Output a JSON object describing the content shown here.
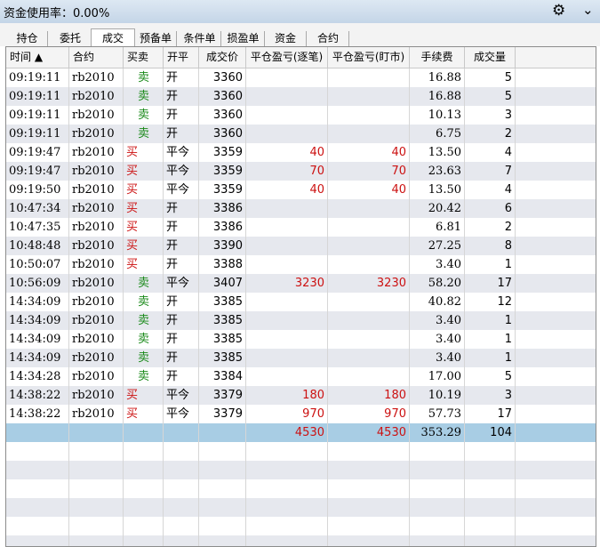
{
  "title_bar": {
    "label": "资金使用率：0.00%"
  },
  "tabs": [
    "持仓",
    "委托",
    "成交",
    "预备单",
    "条件单",
    "损盈单",
    "资金",
    "合约"
  ],
  "active_tab": 2,
  "columns": [
    "时间 ▲",
    "合约",
    "买卖",
    "开平",
    "成交价",
    "平仓盈亏(逐笔)",
    "平仓盈亏(盯市)",
    "手续费",
    "成交量"
  ],
  "rows": [
    {
      "time": "09:19:11",
      "contract": "rb2010",
      "side": "卖",
      "oc": "开",
      "price": "3360",
      "pnl_trade": "",
      "pnl_mark": "",
      "fee": "16.88",
      "qty": "5"
    },
    {
      "time": "09:19:11",
      "contract": "rb2010",
      "side": "卖",
      "oc": "开",
      "price": "3360",
      "pnl_trade": "",
      "pnl_mark": "",
      "fee": "16.88",
      "qty": "5"
    },
    {
      "time": "09:19:11",
      "contract": "rb2010",
      "side": "卖",
      "oc": "开",
      "price": "3360",
      "pnl_trade": "",
      "pnl_mark": "",
      "fee": "10.13",
      "qty": "3"
    },
    {
      "time": "09:19:11",
      "contract": "rb2010",
      "side": "卖",
      "oc": "开",
      "price": "3360",
      "pnl_trade": "",
      "pnl_mark": "",
      "fee": "6.75",
      "qty": "2"
    },
    {
      "time": "09:19:47",
      "contract": "rb2010",
      "side": "买",
      "oc": "平今",
      "price": "3359",
      "pnl_trade": "40",
      "pnl_mark": "40",
      "fee": "13.50",
      "qty": "4"
    },
    {
      "time": "09:19:47",
      "contract": "rb2010",
      "side": "买",
      "oc": "平今",
      "price": "3359",
      "pnl_trade": "70",
      "pnl_mark": "70",
      "fee": "23.63",
      "qty": "7"
    },
    {
      "time": "09:19:50",
      "contract": "rb2010",
      "side": "买",
      "oc": "平今",
      "price": "3359",
      "pnl_trade": "40",
      "pnl_mark": "40",
      "fee": "13.50",
      "qty": "4"
    },
    {
      "time": "10:47:34",
      "contract": "rb2010",
      "side": "买",
      "oc": "开",
      "price": "3386",
      "pnl_trade": "",
      "pnl_mark": "",
      "fee": "20.42",
      "qty": "6"
    },
    {
      "time": "10:47:35",
      "contract": "rb2010",
      "side": "买",
      "oc": "开",
      "price": "3386",
      "pnl_trade": "",
      "pnl_mark": "",
      "fee": "6.81",
      "qty": "2"
    },
    {
      "time": "10:48:48",
      "contract": "rb2010",
      "side": "买",
      "oc": "开",
      "price": "3390",
      "pnl_trade": "",
      "pnl_mark": "",
      "fee": "27.25",
      "qty": "8"
    },
    {
      "time": "10:50:07",
      "contract": "rb2010",
      "side": "买",
      "oc": "开",
      "price": "3388",
      "pnl_trade": "",
      "pnl_mark": "",
      "fee": "3.40",
      "qty": "1"
    },
    {
      "time": "10:56:09",
      "contract": "rb2010",
      "side": "卖",
      "oc": "平今",
      "price": "3407",
      "pnl_trade": "3230",
      "pnl_mark": "3230",
      "fee": "58.20",
      "qty": "17"
    },
    {
      "time": "14:34:09",
      "contract": "rb2010",
      "side": "卖",
      "oc": "开",
      "price": "3385",
      "pnl_trade": "",
      "pnl_mark": "",
      "fee": "40.82",
      "qty": "12"
    },
    {
      "time": "14:34:09",
      "contract": "rb2010",
      "side": "卖",
      "oc": "开",
      "price": "3385",
      "pnl_trade": "",
      "pnl_mark": "",
      "fee": "3.40",
      "qty": "1"
    },
    {
      "time": "14:34:09",
      "contract": "rb2010",
      "side": "卖",
      "oc": "开",
      "price": "3385",
      "pnl_trade": "",
      "pnl_mark": "",
      "fee": "3.40",
      "qty": "1"
    },
    {
      "time": "14:34:09",
      "contract": "rb2010",
      "side": "卖",
      "oc": "开",
      "price": "3385",
      "pnl_trade": "",
      "pnl_mark": "",
      "fee": "3.40",
      "qty": "1"
    },
    {
      "time": "14:34:28",
      "contract": "rb2010",
      "side": "卖",
      "oc": "开",
      "price": "3384",
      "pnl_trade": "",
      "pnl_mark": "",
      "fee": "17.00",
      "qty": "5"
    },
    {
      "time": "14:38:22",
      "contract": "rb2010",
      "side": "买",
      "oc": "平今",
      "price": "3379",
      "pnl_trade": "180",
      "pnl_mark": "180",
      "fee": "10.19",
      "qty": "3"
    },
    {
      "time": "14:38:22",
      "contract": "rb2010",
      "side": "买",
      "oc": "平今",
      "price": "3379",
      "pnl_trade": "970",
      "pnl_mark": "970",
      "fee": "57.73",
      "qty": "17"
    }
  ],
  "totals": {
    "pnl_trade": "4530",
    "pnl_mark": "4530",
    "fee": "353.29",
    "qty": "104"
  },
  "icons": {
    "settings": "gear-icon",
    "dropdown": "chevron-down-icon"
  },
  "colors": {
    "buy": "#cc1111",
    "sell": "#1a8a1a",
    "total_row": "#a8cde4",
    "alt_row": "#e6e8ee"
  }
}
